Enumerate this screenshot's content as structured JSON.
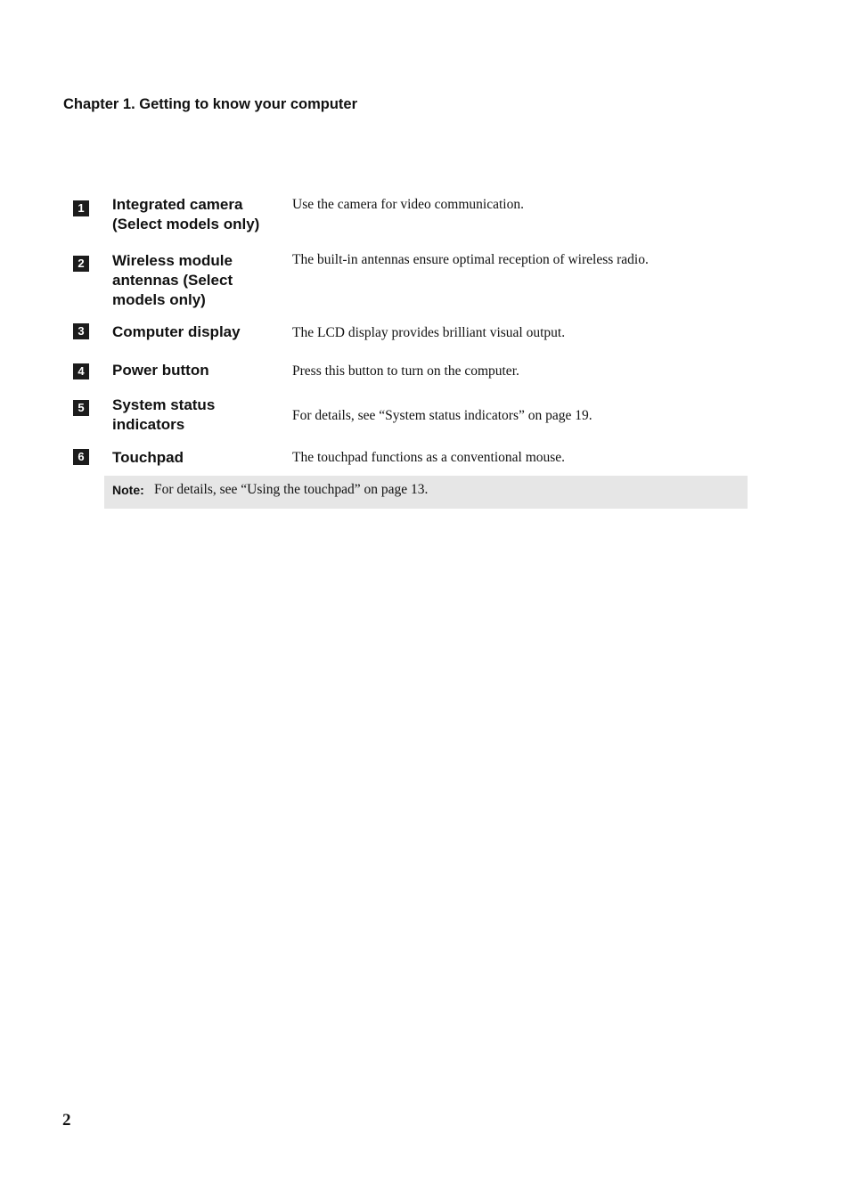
{
  "header": {
    "chapter_title": "Chapter 1. Getting to know your computer"
  },
  "items": [
    {
      "number": "1",
      "term": "Integrated camera (Select models only)",
      "description": "Use the camera for video communication."
    },
    {
      "number": "2",
      "term": "Wireless module antennas (Select models only)",
      "description": "The built-in antennas ensure optimal reception of wireless radio."
    },
    {
      "number": "3",
      "term": "Computer display",
      "description": "The LCD display provides brilliant visual output."
    },
    {
      "number": "4",
      "term": "Power button",
      "description": "Press this button to turn on the computer."
    },
    {
      "number": "5",
      "term": "System status indicators",
      "description": "For details, see “System status indicators” on page 19."
    },
    {
      "number": "6",
      "term": "Touchpad",
      "description": "The touchpad functions as a conventional mouse."
    }
  ],
  "note": {
    "label": "Note:",
    "text": "For details, see “Using the touchpad” on page 13."
  },
  "footer": {
    "page_number": "2"
  }
}
